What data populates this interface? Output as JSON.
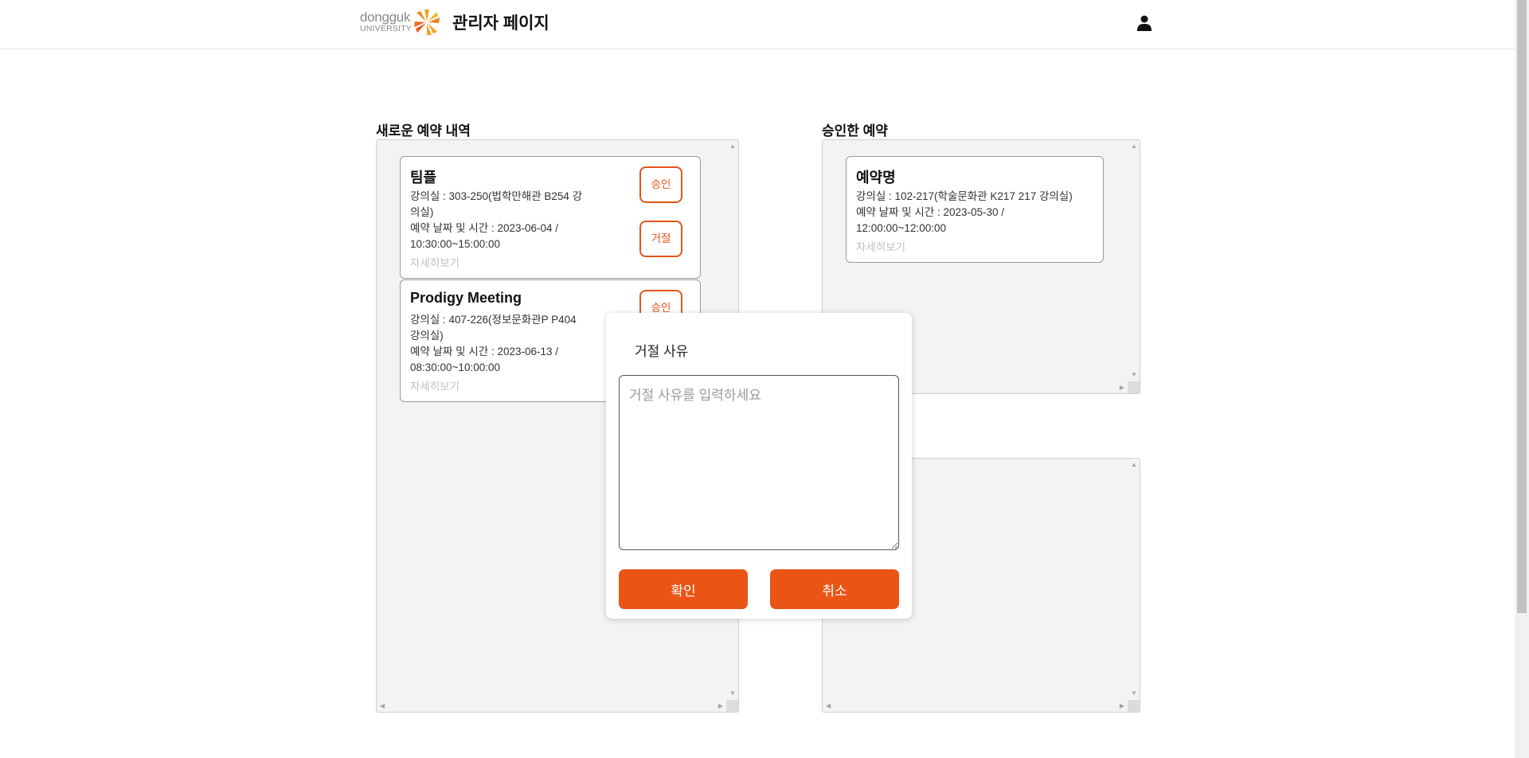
{
  "header": {
    "logo_line1": "dongguk",
    "logo_line2": "UNIVERSITY",
    "title": "관리자 페이지"
  },
  "sections": {
    "new_title": "새로운 예약 내역",
    "approved_title": "승인한 예약"
  },
  "new_reservations": [
    {
      "title": "팀플",
      "room_line1": "강의실 : 303-250(법학만해관 B254 강",
      "room_line2": "의실)",
      "time_line1": "예약 날짜 및 시간 : 2023-06-04 /",
      "time_line2": "10:30:00~15:00:00",
      "more": "자세히보기",
      "approve": "승인",
      "reject": "거절"
    },
    {
      "title": "Prodigy Meeting",
      "room_line1": "강의실 : 407-226(정보문화관P P404",
      "room_line2": "강의실)",
      "time_line1": "예약 날짜 및 시간 : 2023-06-13 /",
      "time_line2": "08:30:00~10:00:00",
      "more": "자세히보기",
      "approve": "승인"
    }
  ],
  "approved_reservations": [
    {
      "title": "예약명",
      "room_line1": "강의실 : 102-217(학술문화관 K217 217 강의실)",
      "time_line1": "예약 날짜 및 시간 : 2023-05-30 /",
      "time_line2": "12:00:00~12:00:00",
      "more": "자세히보기"
    }
  ],
  "modal": {
    "title": "거절 사유",
    "placeholder": "거절 사유를 입력하세요",
    "confirm": "확인",
    "cancel": "취소"
  },
  "colors": {
    "accent": "#ea5516",
    "outline": "#e55519"
  }
}
